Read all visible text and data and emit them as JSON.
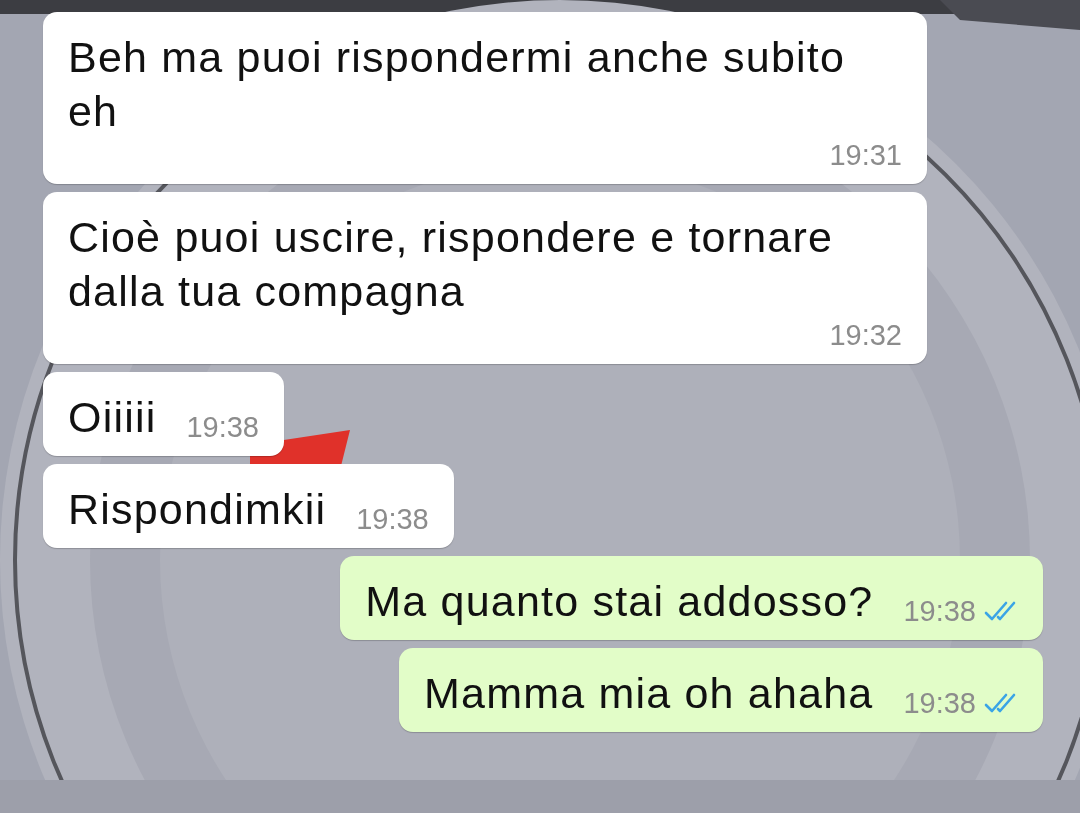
{
  "messages": [
    {
      "kind": "incoming",
      "text": "Beh ma puoi rispondermi anche subito eh",
      "time": "19:31"
    },
    {
      "kind": "incoming",
      "text": "Cioè puoi uscire, rispondere e tornare dalla tua compagna",
      "time": "19:32"
    },
    {
      "kind": "incoming",
      "text": "Oiiiii",
      "time": "19:38"
    },
    {
      "kind": "incoming",
      "text": "Rispondimkii",
      "time": "19:38"
    },
    {
      "kind": "outgoing",
      "text": "Ma quanto stai addosso?",
      "time": "19:38",
      "read": true
    },
    {
      "kind": "outgoing",
      "text": "Mamma mia oh ahaha",
      "time": "19:38",
      "read": true
    }
  ]
}
